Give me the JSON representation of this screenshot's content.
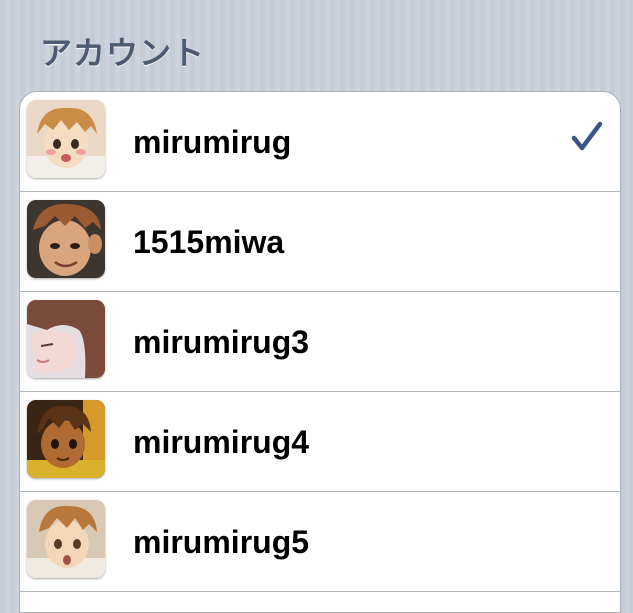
{
  "section": {
    "title": "アカウント"
  },
  "accounts": [
    {
      "name": "mirumirug",
      "selected": true,
      "avatar_icon": "avatar-boy-blushing-icon"
    },
    {
      "name": "1515miwa",
      "selected": false,
      "avatar_icon": "avatar-boy-smiling-icon"
    },
    {
      "name": "mirumirug3",
      "selected": false,
      "avatar_icon": "avatar-boy-profile-icon"
    },
    {
      "name": "mirumirug4",
      "selected": false,
      "avatar_icon": "avatar-boy-dark-icon"
    },
    {
      "name": "mirumirug5",
      "selected": false,
      "avatar_icon": "avatar-boy-surprised-icon"
    }
  ],
  "colors": {
    "accent_check": "#3b5486",
    "header_text": "#4d5a71"
  }
}
